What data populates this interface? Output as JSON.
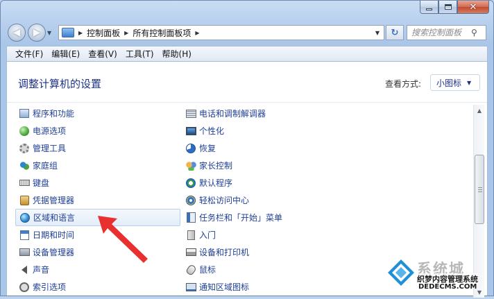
{
  "address": {
    "crumbs": [
      "控制面板",
      "所有控制面板项"
    ]
  },
  "search": {
    "placeholder": "搜索控制面板"
  },
  "menu": [
    "文件(F)",
    "编辑(E)",
    "查看(V)",
    "工具(T)",
    "帮助(H)"
  ],
  "header": {
    "title": "调整计算机的设置",
    "view_label": "查看方式:",
    "view_value": "小图标"
  },
  "items_left": [
    {
      "label": "程序和功能",
      "icon": "programs-icon"
    },
    {
      "label": "电源选项",
      "icon": "power-icon"
    },
    {
      "label": "管理工具",
      "icon": "admin-tools-icon"
    },
    {
      "label": "家庭组",
      "icon": "homegroup-icon"
    },
    {
      "label": "键盘",
      "icon": "keyboard-icon"
    },
    {
      "label": "凭据管理器",
      "icon": "credential-icon"
    },
    {
      "label": "区域和语言",
      "icon": "region-globe-icon"
    },
    {
      "label": "日期和时间",
      "icon": "calendar-icon"
    },
    {
      "label": "设备管理器",
      "icon": "device-manager-icon"
    },
    {
      "label": "声音",
      "icon": "speaker-icon"
    },
    {
      "label": "索引选项",
      "icon": "index-icon"
    }
  ],
  "items_right": [
    {
      "label": "电话和调制解调器",
      "icon": "phone-modem-icon"
    },
    {
      "label": "个性化",
      "icon": "personalization-icon"
    },
    {
      "label": "恢复",
      "icon": "recovery-icon"
    },
    {
      "label": "家长控制",
      "icon": "parental-control-icon"
    },
    {
      "label": "默认程序",
      "icon": "default-programs-icon"
    },
    {
      "label": "轻松访问中心",
      "icon": "ease-of-access-icon"
    },
    {
      "label": "任务栏和「开始」菜单",
      "icon": "taskbar-icon"
    },
    {
      "label": "入门",
      "icon": "getting-started-icon"
    },
    {
      "label": "设备和打印机",
      "icon": "printer-icon"
    },
    {
      "label": "鼠标",
      "icon": "mouse-icon"
    },
    {
      "label": "通知区域图标",
      "icon": "notification-tray-icon"
    }
  ],
  "watermark": {
    "title": "系统城",
    "subtitle": "织梦内容管理系统",
    "url": "DEDECMS.COM"
  },
  "colors": {
    "link": "#1f3f96",
    "title": "#1e3287",
    "arrow": "#e8312f"
  }
}
